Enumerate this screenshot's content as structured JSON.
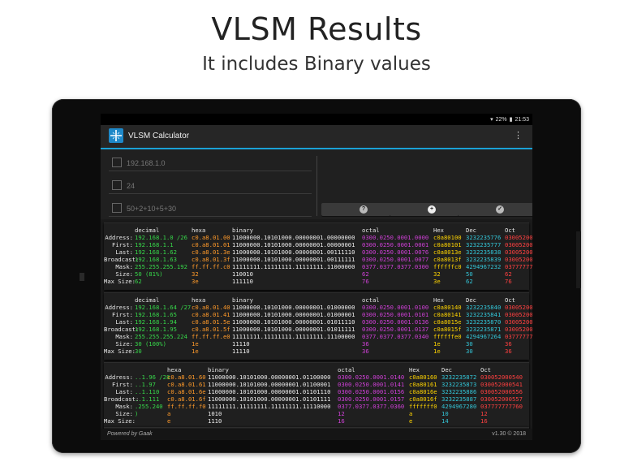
{
  "promo": {
    "title": "VLSM Results",
    "subtitle": "It includes Binary values"
  },
  "status": {
    "battery": "22%",
    "time": "21:53"
  },
  "app": {
    "title": "VLSM Calculator"
  },
  "inputs": {
    "address": "192.168.1.0",
    "mask": "24",
    "hosts": "50+2+10+5+30"
  },
  "row_labels": [
    "Address:",
    "First:",
    "Last:",
    "Broadcast:",
    "Mask:",
    "Size:",
    "Max Size:"
  ],
  "headers": [
    "decimal",
    "hexa",
    "binary",
    "octal",
    "Hex",
    "Dec",
    "Oct"
  ],
  "cards": [
    {
      "rows": [
        [
          "192.168.1.0 /26",
          "c0.a8.01.00",
          "11000000.10101000.00000001.00000000",
          "0300.0250.0001.0000",
          "c0a80100",
          "3232235776",
          "030052000400"
        ],
        [
          "192.168.1.1",
          "c0.a8.01.01",
          "11000000.10101000.00000001.00000001",
          "0300.0250.0001.0001",
          "c0a80101",
          "3232235777",
          "030052000401"
        ],
        [
          "192.168.1.62",
          "c0.a8.01.3e",
          "11000000.10101000.00000001.00111110",
          "0300.0250.0001.0076",
          "c0a8013e",
          "3232235838",
          "030052000476"
        ],
        [
          "192.168.1.63",
          "c0.a8.01.3f",
          "11000000.10101000.00000001.00111111",
          "0300.0250.0001.0077",
          "c0a8013f",
          "3232235839",
          "030052000477"
        ],
        [
          "255.255.255.192",
          "ff.ff.ff.c0",
          "11111111.11111111.11111111.11000000",
          "0377.0377.0377.0300",
          "ffffffc0",
          "4294967232",
          "037777777700"
        ],
        [
          "50 (81%)",
          "32",
          "110010",
          "62",
          "32",
          "50",
          "62"
        ],
        [
          "62",
          "3e",
          "111110",
          "76",
          "3e",
          "62",
          "76"
        ]
      ]
    },
    {
      "rows": [
        [
          "192.168.1.64 /27",
          "c0.a8.01.40",
          "11000000.10101000.00000001.01000000",
          "0300.0250.0001.0100",
          "c0a80140",
          "3232235840",
          "030052000500"
        ],
        [
          "192.168.1.65",
          "c0.a8.01.41",
          "11000000.10101000.00000001.01000001",
          "0300.0250.0001.0101",
          "c0a80141",
          "3232235841",
          "030052000501"
        ],
        [
          "192.168.1.94",
          "c0.a8.01.5e",
          "11000000.10101000.00000001.01011110",
          "0300.0250.0001.0136",
          "c0a8015e",
          "3232235870",
          "030052000536"
        ],
        [
          "192.168.1.95",
          "c0.a8.01.5f",
          "11000000.10101000.00000001.01011111",
          "0300.0250.0001.0137",
          "c0a8015f",
          "3232235871",
          "030052000537"
        ],
        [
          "255.255.255.224",
          "ff.ff.ff.e0",
          "11111111.11111111.11111111.11100000",
          "0377.0377.0377.0340",
          "ffffffe0",
          "4294967264",
          "037777777740"
        ],
        [
          "30 (100%)",
          "1e",
          "11110",
          "36",
          "1e",
          "30",
          "36"
        ],
        [
          "30",
          "1e",
          "11110",
          "36",
          "1e",
          "30",
          "36"
        ]
      ]
    },
    {
      "rows": [
        [
          "..1.96 /28",
          "c0.a8.01.60",
          "11000000.10101000.00000001.01100000",
          "0300.0250.0001.0140",
          "c0a80160",
          "3232235872",
          "030052000540"
        ],
        [
          "..1.97",
          "c0.a8.01.61",
          "11000000.10101000.00000001.01100001",
          "0300.0250.0001.0141",
          "c0a80161",
          "3232235873",
          "030052000541"
        ],
        [
          "..1.110",
          "c0.a8.01.6e",
          "11000000.10101000.00000001.01101110",
          "0300.0250.0001.0156",
          "c0a8016e",
          "3232235886",
          "030052000556"
        ],
        [
          "..1.111",
          "c0.a8.01.6f",
          "11000000.10101000.00000001.01101111",
          "0300.0250.0001.0157",
          "c0a8016f",
          "3232235887",
          "030052000557"
        ],
        [
          ".255.240",
          "ff.ff.ff.f0",
          "11111111.11111111.11111111.11110000",
          "0377.0377.0377.0360",
          "fffffff0",
          "4294967280",
          "037777777760"
        ],
        [
          ")",
          "a",
          "1010",
          "12",
          "a",
          "10",
          "12"
        ],
        [
          "",
          "e",
          "1110",
          "16",
          "e",
          "14",
          "16"
        ]
      ]
    }
  ],
  "footer": {
    "left": "Powered by Gaak",
    "right": "v1.30 © 2018"
  }
}
